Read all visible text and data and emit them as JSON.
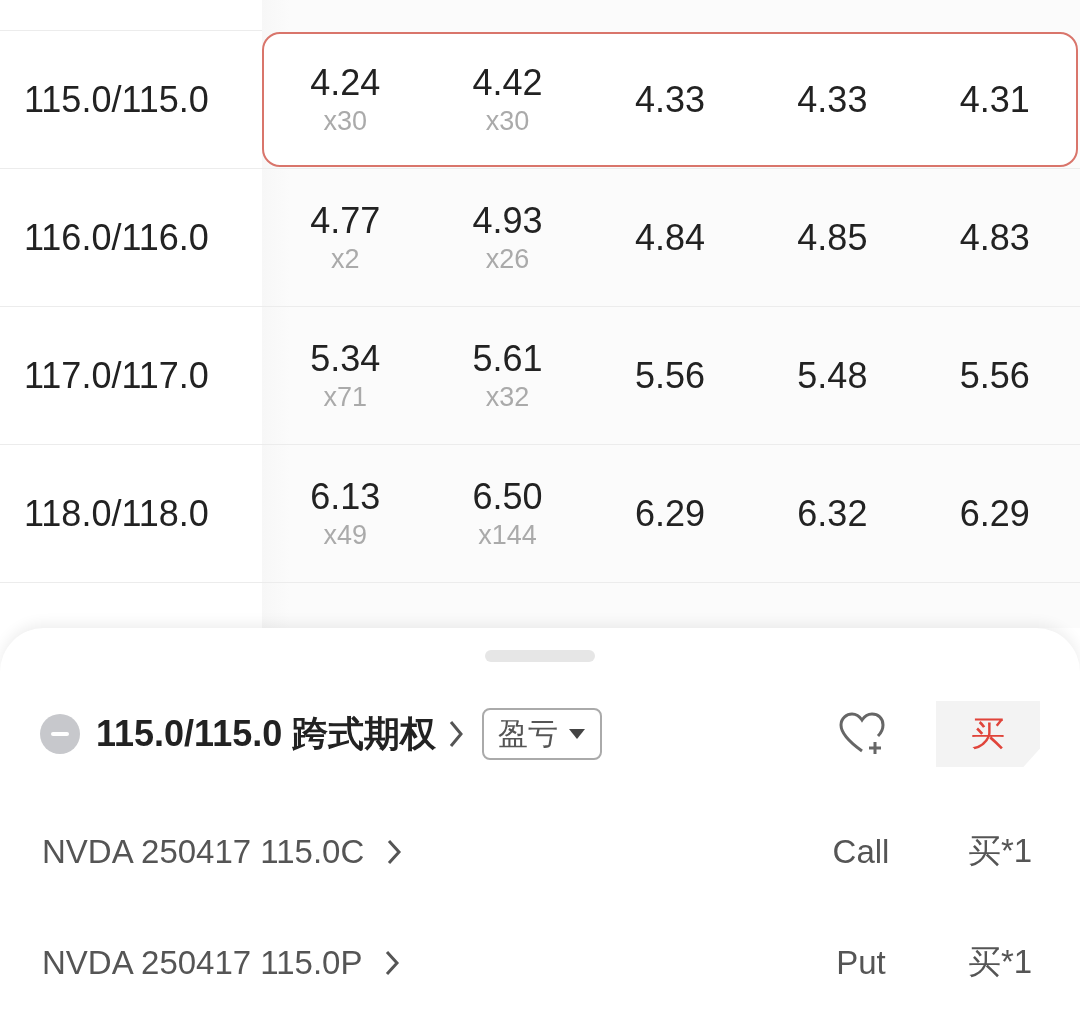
{
  "rows": [
    {
      "strike": "115.0/115.0",
      "bid": "4.24",
      "bid_size": "x30",
      "ask": "4.42",
      "ask_size": "x30",
      "column_4": "4.33",
      "column_5": "4.33",
      "column_6": "4.31",
      "selected": true
    },
    {
      "strike": "116.0/116.0",
      "bid": "4.77",
      "bid_size": "x2",
      "ask": "4.93",
      "ask_size": "x26",
      "column_4": "4.84",
      "column_5": "4.85",
      "column_6": "4.83",
      "selected": false
    },
    {
      "strike": "117.0/117.0",
      "bid": "5.34",
      "bid_size": "x71",
      "ask": "5.61",
      "ask_size": "x32",
      "column_4": "5.56",
      "column_5": "5.48",
      "column_6": "5.56",
      "selected": false
    },
    {
      "strike": "118.0/118.0",
      "bid": "6.13",
      "bid_size": "x49",
      "ask": "6.50",
      "ask_size": "x144",
      "column_4": "6.29",
      "column_5": "6.32",
      "column_6": "6.29",
      "selected": false
    }
  ],
  "sheet": {
    "title": "115.0/115.0 跨式期权",
    "dropdown": "盈亏",
    "buy_button": "买",
    "legs": [
      {
        "contract": "NVDA 250417 115.0C",
        "type": "Call",
        "action": "买*1"
      },
      {
        "contract": "NVDA 250417 115.0P",
        "type": "Put",
        "action": "买*1"
      }
    ]
  }
}
